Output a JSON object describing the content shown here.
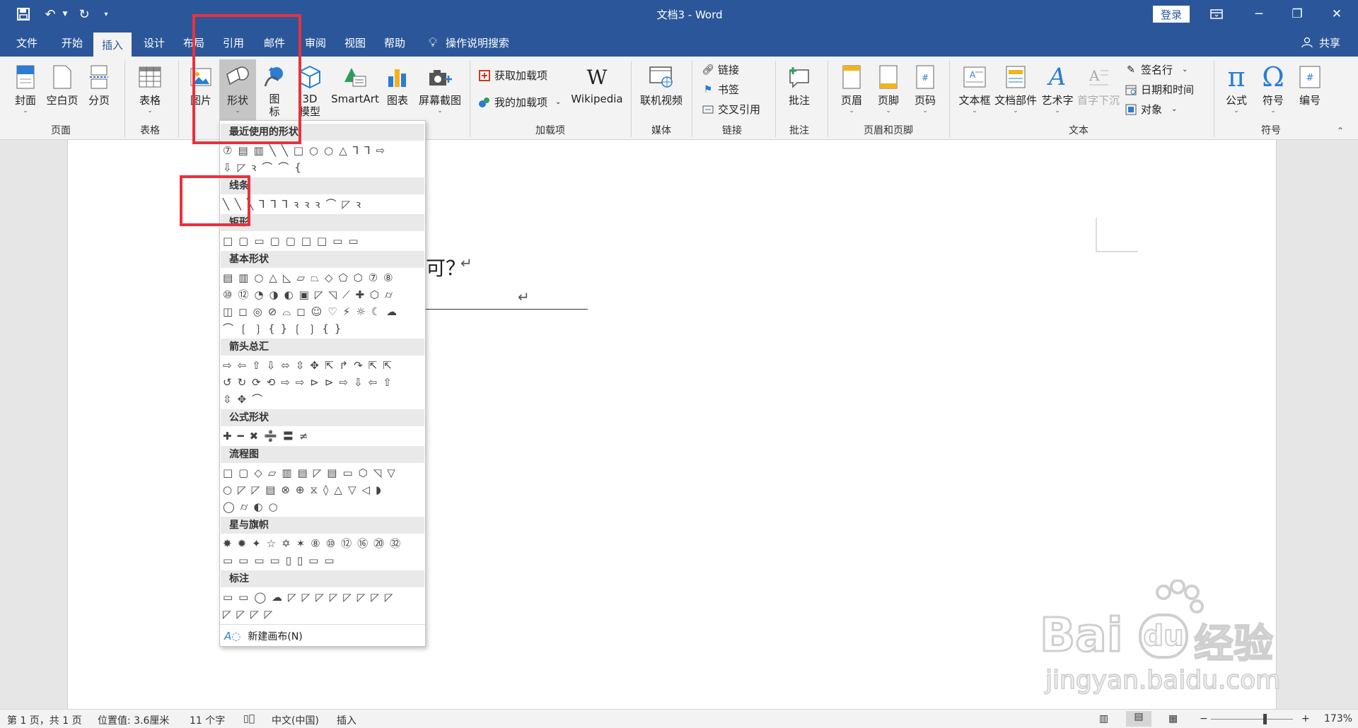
{
  "titlebar": {
    "title": "文档3  -  Word",
    "login": "登录",
    "qat": {
      "save_icon": "save-icon",
      "undo_icon": "undo-icon",
      "redo_icon": "redo-icon",
      "customize_icon": "chevron-down-icon"
    },
    "controls": {
      "ribbon_display": "ribbon-display-icon",
      "minimize": "minimize-icon",
      "restore": "restore-icon",
      "close": "close-icon"
    }
  },
  "tabs": [
    {
      "label": "文件"
    },
    {
      "label": "开始"
    },
    {
      "label": "插入"
    },
    {
      "label": "设计"
    },
    {
      "label": "布局"
    },
    {
      "label": "引用"
    },
    {
      "label": "邮件"
    },
    {
      "label": "审阅"
    },
    {
      "label": "视图"
    },
    {
      "label": "帮助"
    }
  ],
  "search_label": "操作说明搜索",
  "share_label": "共享",
  "ribbon": {
    "page_group": {
      "label": "页面",
      "buttons": [
        "封面",
        "空白页",
        "分页"
      ]
    },
    "table_group": {
      "label": "表格",
      "buttons": [
        "表格"
      ]
    },
    "illus": {
      "picture": "图片",
      "shapes": "形状",
      "icons_a": "图",
      "icons_b": "标",
      "model_a": "3D",
      "model_b": "模型",
      "smartart": "SmartArt",
      "chart": "图表",
      "screenshot": "屏幕截图"
    },
    "addins_group": {
      "label": "加载项",
      "get": "获取加载项",
      "my": "我的加载项",
      "wiki": "Wikipedia"
    },
    "media_group": {
      "label": "媒体",
      "online_video": "联机视频"
    },
    "links_group": {
      "label": "链接",
      "link": "链接",
      "bookmark": "书签",
      "xref": "交叉引用"
    },
    "comment_group": {
      "label": "批注",
      "comment": "批注"
    },
    "hf_group": {
      "label": "页眉和页脚",
      "header": "页眉",
      "footer": "页脚",
      "page_number": "页码"
    },
    "text_group": {
      "label": "文本",
      "textbox": "文本框",
      "quickparts": "文档部件",
      "wordart": "艺术字",
      "dropcap": "首字下沉",
      "signature": "签名行",
      "datetime": "日期和时间",
      "object": "对象"
    },
    "symbols_group": {
      "label": "符号",
      "equation": "公式",
      "symbol": "符号",
      "numbering": "编号"
    }
  },
  "document": {
    "text_fragment": "可？",
    "return_mark": "↵"
  },
  "shapes_menu": {
    "sections": [
      {
        "title": "最近使用的形状",
        "rows": [
          "⑦▤▥╲╲□○○△⅂⅂⇨",
          "⇩◸ꝛ⌒⌒{"
        ]
      },
      {
        "title": "线条",
        "rows": [
          "╲╲╲⅂⅂⅂ꝛꝛꝛ⌒◸ꝛ"
        ]
      },
      {
        "title": "矩形",
        "rows": [
          "□▢▭▢▢□□▭▭"
        ]
      },
      {
        "title": "基本形状",
        "rows": [
          "▤▥○△◺▱⏢◇⬠⬡⑦⑧",
          "⑩⑫◔◑◐▣◸◹⟋✚⬡⌭",
          "◫◻◎⊘⌓◻☺♡⚡☼☾☁",
          "⌒❲❳{}❲❳{}"
        ]
      },
      {
        "title": "箭头总汇",
        "rows": [
          "⇨⇦⇧⇩⬄⇳✥⇱↱↷⇱⇱",
          "↺↻⟳⟲⇨⇨⊳⊳⇨⇩⇦⇧",
          "⇳✥⌒"
        ]
      },
      {
        "title": "公式形状",
        "rows": [
          "✚━✖➗〓≠"
        ]
      },
      {
        "title": "流程图",
        "rows": [
          "□▢◇▱▥▤◸▤▭⬡◹▽",
          "○◸◸▤⊗⊕⧖◊△▽◁◗",
          "◯⌭◐○"
        ]
      },
      {
        "title": "星与旗帜",
        "rows": [
          "✸✹✦☆✡✶⑧⑩⑫⑯⑳㉜",
          "▭▭▭▭▯▯▭▭"
        ]
      },
      {
        "title": "标注",
        "rows": [
          "▭▭◯☁◸◸◸◸◸◸◸◸",
          "◸◸◸◸"
        ]
      }
    ],
    "new_canvas": "新建画布(N)"
  },
  "statusbar": {
    "page": "第 1 页，共 1 页",
    "position": "位置值: 3.6厘米",
    "words": "11 个字",
    "language": "中文(中国)",
    "mode": "插入",
    "zoom": "173%"
  },
  "watermark": {
    "brand": "Bai",
    "brand2": "du",
    "cn": "经验",
    "url": "jingyan.baidu.com"
  },
  "colors": {
    "accent": "#2b579a",
    "highlight": "#e8323c"
  }
}
